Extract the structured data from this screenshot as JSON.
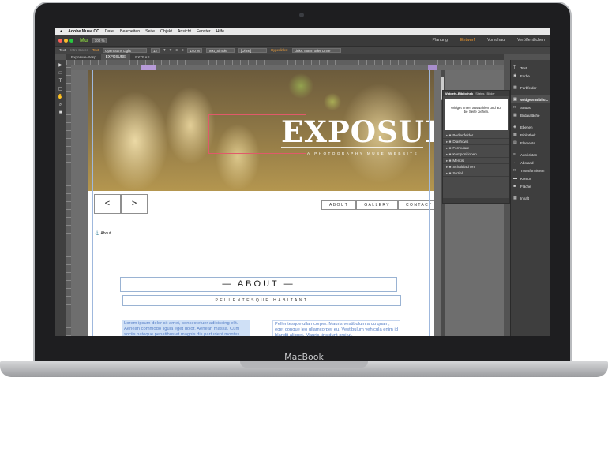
{
  "device": {
    "brand": "MacBook"
  },
  "menubar": {
    "apple": "",
    "items": [
      "Adobe Muse CC",
      "Datei",
      "Bearbeiten",
      "Seite",
      "Objekt",
      "Ansicht",
      "Fenster",
      "Hilfe"
    ]
  },
  "appbar": {
    "logo": "Mu",
    "zoom": "100 %",
    "modes": [
      "Planung",
      "Entwurf",
      "Vorschau",
      "Veröffentlichen"
    ],
    "active_mode": "Entwurf"
  },
  "control": {
    "text_label": "Text:",
    "text_value": "Intro Stores",
    "style_label": "Text",
    "font": "Open Sans Light",
    "size": "12",
    "tracking": "140 %",
    "paragraph_style": "Text_Simple",
    "char_style": "[Ohne]",
    "hyperlink_label": "Hyperlinks:",
    "hyperlink_value": "Links: Intern oder Ohne"
  },
  "tabs": [
    "Exposure-Resp",
    "EXPOSURE",
    "EXTRAS"
  ],
  "active_tab": "EXPOSURE",
  "hero": {
    "title": "EXPOSURE",
    "subtitle": "A PHOTOGRAPHY MUSE WEBSITE"
  },
  "pager": {
    "prev": "<",
    "next": ">"
  },
  "nav": [
    "ABOUT",
    "GALLERY",
    "CONTACT"
  ],
  "anchor_label": "About",
  "about": {
    "title": "— ABOUT —",
    "subtitle": "PELLENTESQUE HABITANT"
  },
  "body_text": {
    "col1": "Lorem ipsum dolor sit amet, consectetuer adipiscing elit. Aenean commodo ligula eget dolor. Aenean massa. Cum sociis natoque penatibus et magnis dis parturient montes.",
    "col2": "Pellentesque ullamcorper. Mauris vestibulum arcu quam, eget congue leo ullamcorper eu. Vestibulum vehicula enim id blandit aliquet. Mauris tincidunt orci ut."
  },
  "widgets_panel": {
    "tabs": [
      "Widgets-Bibliothek",
      "Status",
      "Bilder"
    ],
    "preview_text": "Widget unten auswählen und auf die Seite ziehen.",
    "items": [
      "Bedienfelder",
      "Diashows",
      "Formulare",
      "Kompositionen",
      "Menüs",
      "Schaltflächen",
      "Soziel"
    ]
  },
  "right_panel": {
    "items": [
      "Text",
      "Farbe",
      "Farbfelder",
      "Widgets-Biblio...",
      "Status",
      "Bildaufläche",
      "Ebenen",
      "Bibliothek",
      "Elemente",
      "Ausrichten",
      "Abstand",
      "Transformieren",
      "Kontur",
      "Fläche",
      "Inhalt"
    ],
    "active": "Widgets-Biblio..."
  },
  "colors": {
    "accent_orange": "#f29a2e",
    "muse_green": "#7fbf3f",
    "selection_blue": "#9fb8dd"
  }
}
